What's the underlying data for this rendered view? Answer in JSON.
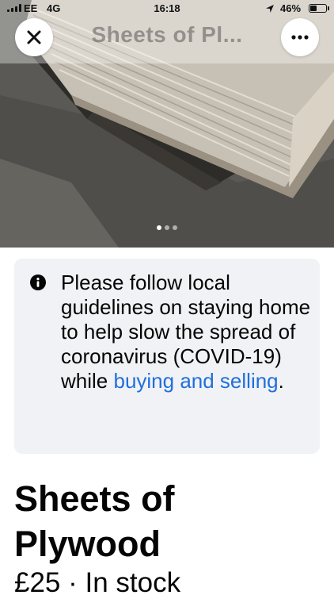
{
  "status_bar": {
    "carrier": "EE",
    "network": "4G",
    "time": "16:18",
    "battery_percent": "46%",
    "battery_level": 0.46
  },
  "header": {
    "title": "Sheets of Pl...",
    "close_icon": "close-icon",
    "more_icon": "more-options-icon"
  },
  "gallery": {
    "photo_count": 3,
    "active_index": 0
  },
  "notice": {
    "icon": "info-icon",
    "text": "Please follow local guidelines on staying home to help slow the spread of coronavirus (COVID-19) while ",
    "link_text": "buying and selling",
    "text_end": ".",
    "link_color": "#216fdb",
    "background": "#f0f2f5"
  },
  "listing": {
    "title": "Sheets of Plywood",
    "price": "£25",
    "separator": " · ",
    "availability": "In stock"
  }
}
